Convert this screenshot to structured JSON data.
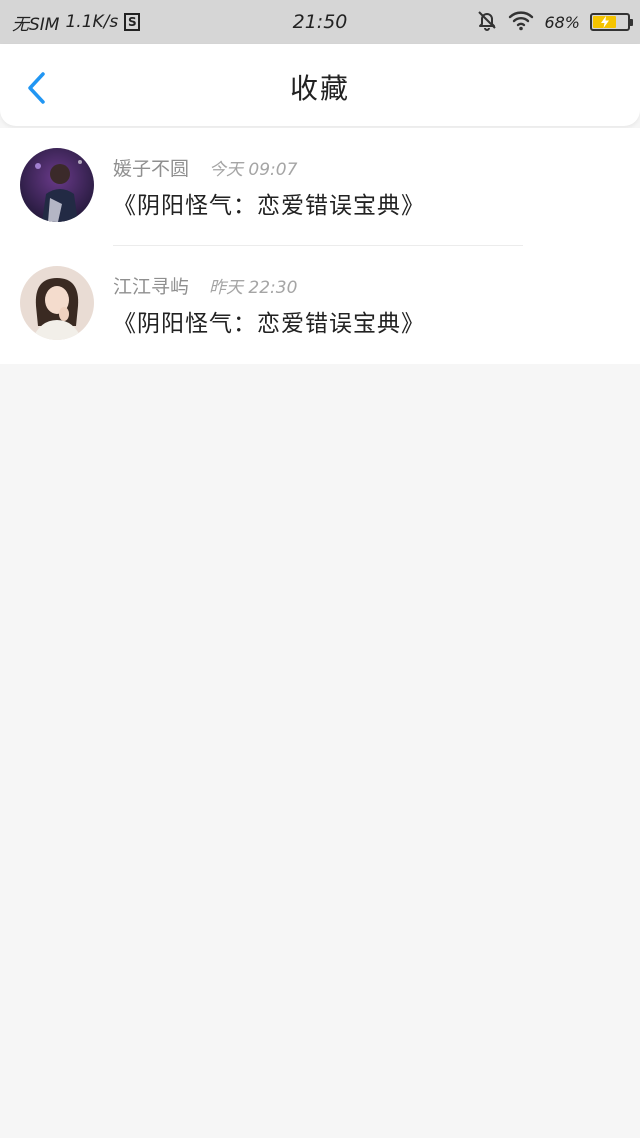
{
  "status_bar": {
    "carrier": "无SIM",
    "net_speed": "1.1K/s",
    "sim_badge": "S",
    "time": "21:50",
    "battery_percent": "68%",
    "battery_level": 0.68,
    "icons": [
      "mute-bell-icon",
      "wifi-icon",
      "battery-icon"
    ]
  },
  "nav": {
    "title": "收藏",
    "back_icon": "chevron-left-icon",
    "accent_color": "#2196f3"
  },
  "favorites": [
    {
      "user": "媛子不圆",
      "time": "今天 09:07",
      "title": "《阴阳怪气：恋爱错误宝典》",
      "avatar": "avatar-photo"
    },
    {
      "user": "江江寻屿",
      "time": "昨天 22:30",
      "title": "《阴阳怪气：恋爱错误宝典》",
      "avatar": "avatar-photo"
    }
  ]
}
